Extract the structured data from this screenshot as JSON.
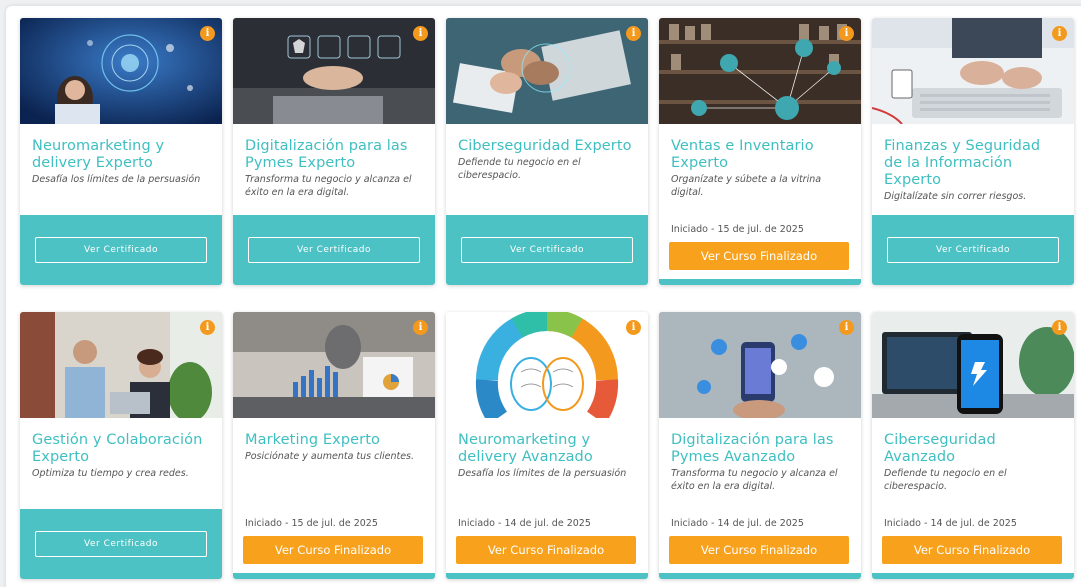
{
  "cards": [
    {
      "title": "Neuromarketing y delivery Experto",
      "subtitle": "Desafía los límites de la persuasión",
      "status": "certificate",
      "button_label": "Ver Certificado",
      "started": "",
      "info": "i"
    },
    {
      "title": "Digitalización para las Pymes Experto",
      "subtitle": "Transforma tu negocio y alcanza el éxito en la era digital.",
      "status": "certificate",
      "button_label": "Ver Certificado",
      "started": "",
      "info": "i"
    },
    {
      "title": "Ciberseguridad Experto",
      "subtitle": "Defiende tu negocio en el ciberespacio.",
      "status": "certificate",
      "button_label": "Ver Certificado",
      "started": "",
      "info": "i"
    },
    {
      "title": "Ventas e Inventario Experto",
      "subtitle": "Organízate y súbete a la vitrina digital.",
      "status": "finished",
      "button_label": "Ver Curso Finalizado",
      "started": "Iniciado - 15 de jul. de 2025",
      "info": "i"
    },
    {
      "title": "Finanzas y Seguridad de la Información Experto",
      "subtitle": "Digitalízate sin correr riesgos.",
      "status": "certificate",
      "button_label": "Ver Certificado",
      "started": "",
      "info": "i"
    },
    {
      "title": "Gestión y Colaboración Experto",
      "subtitle": "Optimiza tu tiempo y crea redes.",
      "status": "certificate",
      "button_label": "Ver Certificado",
      "started": "",
      "info": "i"
    },
    {
      "title": "Marketing Experto",
      "subtitle": "Posiciónate y aumenta tus clientes.",
      "status": "finished",
      "button_label": "Ver Curso Finalizado",
      "started": "Iniciado - 15 de jul. de 2025",
      "info": "i"
    },
    {
      "title": "Neuromarketing y delivery Avanzado",
      "subtitle": "Desafía los límites de la persuasión",
      "status": "finished",
      "button_label": "Ver Curso Finalizado",
      "started": "Iniciado - 14 de jul. de 2025",
      "info": "i"
    },
    {
      "title": "Digitalización para las Pymes Avanzado",
      "subtitle": "Transforma tu negocio y alcanza el éxito en la era digital.",
      "status": "finished",
      "button_label": "Ver Curso Finalizado",
      "started": "Iniciado - 14 de jul. de 2025",
      "info": "i"
    },
    {
      "title": "Ciberseguridad Avanzado",
      "subtitle": "Defiende tu negocio en el ciberespacio.",
      "status": "finished",
      "button_label": "Ver Curso Finalizado",
      "started": "Iniciado - 14 de jul. de 2025",
      "info": "i"
    }
  ],
  "colors": {
    "accent_teal": "#4dc2c4",
    "title_teal": "#3fbfc1",
    "orange": "#f8a11c",
    "info_orange": "#f39a1e"
  },
  "icons": {
    "info": "info-icon"
  }
}
